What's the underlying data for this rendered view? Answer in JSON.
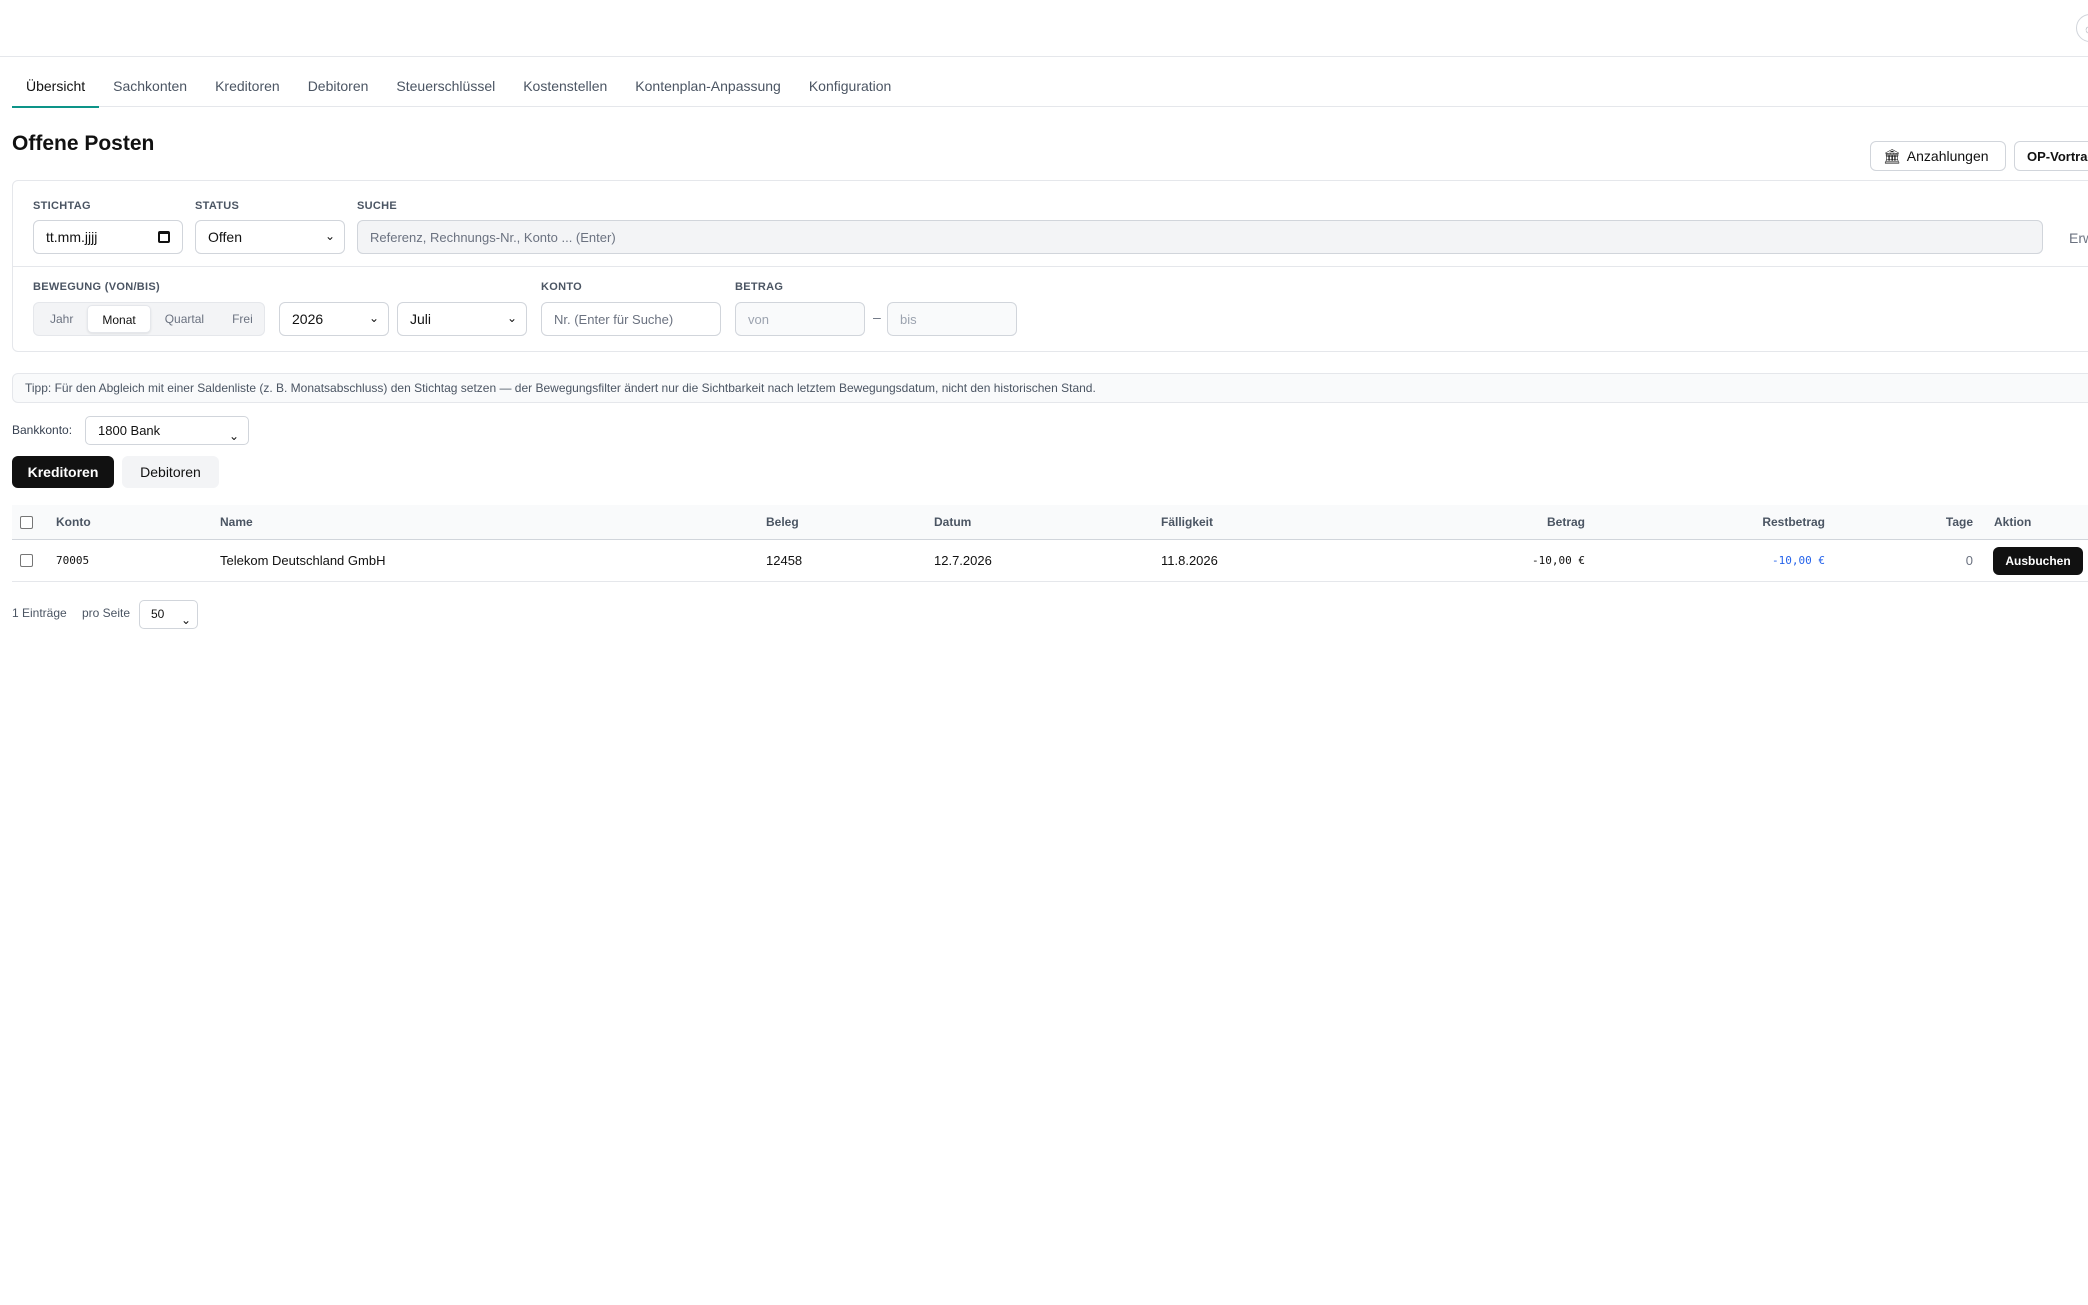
{
  "tabs": [
    {
      "label": "Übersicht"
    },
    {
      "label": "Sachkonten"
    },
    {
      "label": "Kreditoren"
    },
    {
      "label": "Debitoren"
    },
    {
      "label": "Steuerschlüssel"
    },
    {
      "label": "Kostenstellen"
    },
    {
      "label": "Kontenplan-Anpassung"
    },
    {
      "label": "Konfiguration"
    }
  ],
  "active_tab": "Übersicht",
  "page_title": "Offene Posten",
  "header_buttons": {
    "anzahlungen": "Anzahlungen",
    "op_vortrag": "OP-Vortrag"
  },
  "filters": {
    "stichtag": {
      "label": "STICHTAG",
      "value": "tt.mm.jjjj"
    },
    "status": {
      "label": "STATUS",
      "value": "Offen"
    },
    "suche": {
      "label": "SUCHE",
      "placeholder": "Referenz, Rechnungs-Nr., Konto ... (Enter)"
    },
    "erweitert_label": "Erwe",
    "bewegung": {
      "label": "BEWEGUNG (VON/BIS)",
      "options": [
        "Jahr",
        "Monat",
        "Quartal",
        "Frei"
      ],
      "selected": "Monat"
    },
    "year": "2026",
    "month": "Juli",
    "konto": {
      "label": "KONTO",
      "placeholder": "Nr. (Enter für Suche)"
    },
    "betrag": {
      "label": "BETRAG",
      "von_placeholder": "von",
      "separator": "–",
      "bis_placeholder": "bis"
    }
  },
  "tip": "Tipp: Für den Abgleich mit einer Saldenliste (z. B. Monatsabschluss) den Stichtag setzen — der Bewegungsfilter ändert nur die Sichtbarkeit nach letztem Bewegungsdatum, nicht den historischen Stand.",
  "bankkonto": {
    "label": "Bankkonto:",
    "value": "1800 Bank"
  },
  "toggle": {
    "kreditoren": "Kreditoren",
    "debitoren": "Debitoren",
    "selected": "Kreditoren"
  },
  "table": {
    "columns": [
      "Konto",
      "Name",
      "Beleg",
      "Datum",
      "Fälligkeit",
      "Betrag",
      "Restbetrag",
      "Tage",
      "Aktion"
    ],
    "rows": [
      {
        "konto": "70005",
        "name": "Telekom Deutschland GmbH",
        "beleg": "12458",
        "datum": "12.7.2026",
        "faelligkeit": "11.8.2026",
        "betrag": "-10,00 €",
        "restbetrag": "-10,00 €",
        "tage": "0",
        "aktion": "Ausbuchen"
      }
    ]
  },
  "footer": {
    "count": "1 Einträge",
    "per_page_label": "pro Seite",
    "per_page": "50"
  },
  "colors": {
    "accent": "#0d9488",
    "restbetrag": "#2563eb",
    "primary_button": "#111111"
  }
}
